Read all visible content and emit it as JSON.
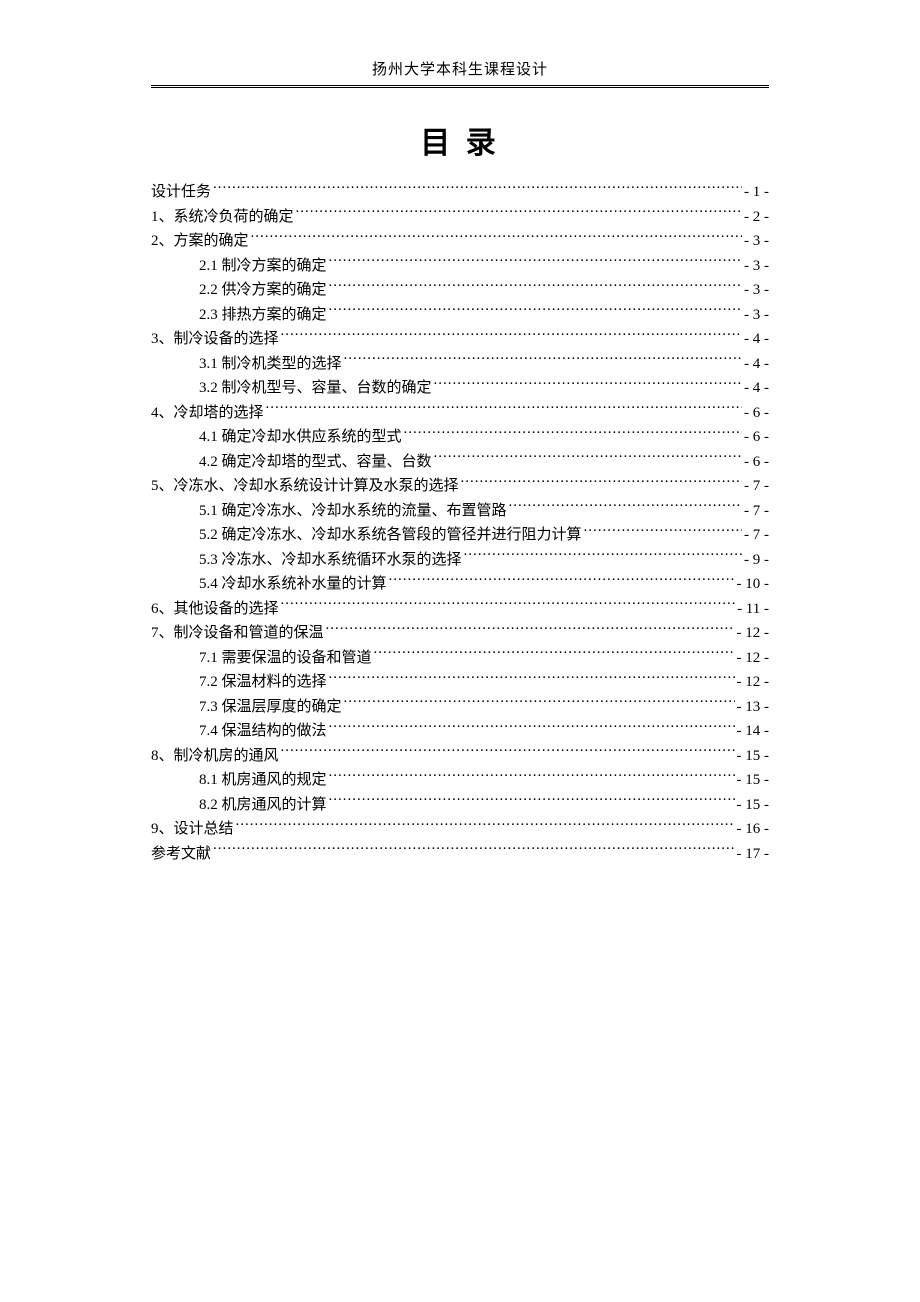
{
  "header": "扬州大学本科生课程设计",
  "title": "目 录",
  "toc": [
    {
      "label": "设计任务",
      "page": "- 1 -",
      "level": 0
    },
    {
      "label": "1、系统冷负荷的确定",
      "page": "- 2 -",
      "level": 0
    },
    {
      "label": "2、方案的确定",
      "page": "- 3 -",
      "level": 0
    },
    {
      "label": "2.1 制冷方案的确定",
      "page": "- 3 -",
      "level": 1
    },
    {
      "label": "2.2 供冷方案的确定",
      "page": "- 3 -",
      "level": 1
    },
    {
      "label": "2.3 排热方案的确定",
      "page": "- 3 -",
      "level": 1
    },
    {
      "label": "3、制冷设备的选择",
      "page": "- 4 -",
      "level": 0
    },
    {
      "label": "3.1 制冷机类型的选择",
      "page": "- 4 -",
      "level": 1
    },
    {
      "label": "3.2 制冷机型号、容量、台数的确定",
      "page": "- 4 -",
      "level": 1
    },
    {
      "label": "4、冷却塔的选择",
      "page": "- 6 -",
      "level": 0
    },
    {
      "label": "4.1 确定冷却水供应系统的型式",
      "page": "- 6 -",
      "level": 1
    },
    {
      "label": "4.2 确定冷却塔的型式、容量、台数",
      "page": "- 6 -",
      "level": 1
    },
    {
      "label": "5、冷冻水、冷却水系统设计计算及水泵的选择",
      "page": "- 7 -",
      "level": 0
    },
    {
      "label": "5.1 确定冷冻水、冷却水系统的流量、布置管路",
      "page": "- 7 -",
      "level": 1
    },
    {
      "label": "5.2 确定冷冻水、冷却水系统各管段的管径并进行阻力计算",
      "page": "- 7 -",
      "level": 1
    },
    {
      "label": "5.3 冷冻水、冷却水系统循环水泵的选择",
      "page": "- 9 -",
      "level": 1
    },
    {
      "label": "5.4 冷却水系统补水量的计算",
      "page": "- 10 -",
      "level": 1
    },
    {
      "label": "6、其他设备的选择",
      "page": "- 11 -",
      "level": 0
    },
    {
      "label": "7、制冷设备和管道的保温",
      "page": "- 12 -",
      "level": 0
    },
    {
      "label": "7.1 需要保温的设备和管道",
      "page": "- 12 -",
      "level": 1
    },
    {
      "label": "7.2 保温材料的选择",
      "page": "- 12 -",
      "level": 1
    },
    {
      "label": "7.3 保温层厚度的确定",
      "page": "- 13 -",
      "level": 1
    },
    {
      "label": "7.4 保温结构的做法",
      "page": "- 14 -",
      "level": 1
    },
    {
      "label": "8、制冷机房的通风",
      "page": "- 15 -",
      "level": 0
    },
    {
      "label": "8.1 机房通风的规定",
      "page": "- 15 -",
      "level": 1
    },
    {
      "label": "8.2 机房通风的计算",
      "page": "- 15 -",
      "level": 1
    },
    {
      "label": "9、设计总结",
      "page": "- 16 -",
      "level": 0
    },
    {
      "label": "参考文献",
      "page": "- 17 -",
      "level": 0
    }
  ]
}
